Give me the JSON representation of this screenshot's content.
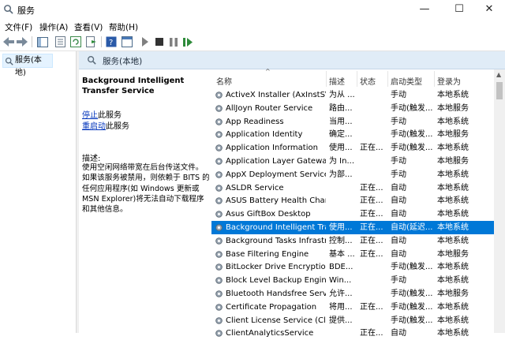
{
  "window": {
    "title": "服务",
    "icon": "gear-magnifier-icon",
    "minimize_glyph": "—",
    "maximize_glyph": "☐",
    "close_glyph": "✕"
  },
  "menu": [
    "文件(F)",
    "操作(A)",
    "查看(V)",
    "帮助(H)"
  ],
  "tree": {
    "selected_label": "服务(本地)"
  },
  "content_header": {
    "label": "服务(本地)"
  },
  "detail": {
    "service_name": "Background Intelligent Transfer Service",
    "stop_link": "停止",
    "stop_suffix": "此服务",
    "restart_link": "重启动",
    "restart_suffix": "此服务",
    "description_label": "描述:",
    "description_text": "使用空闲网络带宽在后台传送文件。如果该服务被禁用，则依赖于 BITS 的任何应用程序(如 Windows 更新或 MSN Explorer)将无法自动下载程序和其他信息。"
  },
  "table": {
    "sort_glyph": "^",
    "columns": [
      "名称",
      "描述",
      "状态",
      "启动类型",
      "登录为"
    ],
    "rows": [
      {
        "name": "ActiveX Installer (AxInstSV)",
        "desc": "为从 ...",
        "state": "",
        "startup": "手动",
        "login": "本地系统"
      },
      {
        "name": "AllJoyn Router Service",
        "desc": "路由...",
        "state": "",
        "startup": "手动(触发...",
        "login": "本地服务"
      },
      {
        "name": "App Readiness",
        "desc": "当用...",
        "state": "",
        "startup": "手动",
        "login": "本地系统"
      },
      {
        "name": "Application Identity",
        "desc": "确定...",
        "state": "",
        "startup": "手动(触发...",
        "login": "本地服务"
      },
      {
        "name": "Application Information",
        "desc": "使用...",
        "state": "正在...",
        "startup": "手动(触发...",
        "login": "本地系统"
      },
      {
        "name": "Application Layer Gateway ...",
        "desc": "为 In...",
        "state": "",
        "startup": "手动",
        "login": "本地服务"
      },
      {
        "name": "AppX Deployment Service ...",
        "desc": "为部...",
        "state": "",
        "startup": "手动",
        "login": "本地系统"
      },
      {
        "name": "ASLDR Service",
        "desc": "",
        "state": "正在...",
        "startup": "自动",
        "login": "本地系统"
      },
      {
        "name": "ASUS Battery Health Charg...",
        "desc": "",
        "state": "正在...",
        "startup": "自动",
        "login": "本地系统"
      },
      {
        "name": "Asus GiftBox Desktop",
        "desc": "",
        "state": "正在...",
        "startup": "自动",
        "login": "本地系统"
      },
      {
        "name": "Background Intelligent Tra...",
        "desc": "使用...",
        "state": "正在...",
        "startup": "自动(延迟...",
        "login": "本地系统",
        "selected": true
      },
      {
        "name": "Background Tasks Infrastru...",
        "desc": "控制...",
        "state": "正在...",
        "startup": "自动",
        "login": "本地系统"
      },
      {
        "name": "Base Filtering Engine",
        "desc": "基本 ...",
        "state": "正在...",
        "startup": "自动",
        "login": "本地服务"
      },
      {
        "name": "BitLocker Drive Encryption ...",
        "desc": "BDE...",
        "state": "",
        "startup": "手动(触发...",
        "login": "本地系统"
      },
      {
        "name": "Block Level Backup Engine ...",
        "desc": "Win...",
        "state": "",
        "startup": "手动",
        "login": "本地系统"
      },
      {
        "name": "Bluetooth Handsfree Service",
        "desc": "允许...",
        "state": "",
        "startup": "手动(触发...",
        "login": "本地服务"
      },
      {
        "name": "Certificate Propagation",
        "desc": "将用...",
        "state": "正在...",
        "startup": "手动(触发...",
        "login": "本地系统"
      },
      {
        "name": "Client License Service (Clip...",
        "desc": "提供...",
        "state": "",
        "startup": "手动(触发...",
        "login": "本地系统"
      },
      {
        "name": "ClientAnalyticsService",
        "desc": "",
        "state": "正在...",
        "startup": "自动",
        "login": "本地系统"
      }
    ]
  },
  "colors": {
    "selection": "#0078d7",
    "header": "#e0ecf7",
    "link": "#0033bb"
  }
}
